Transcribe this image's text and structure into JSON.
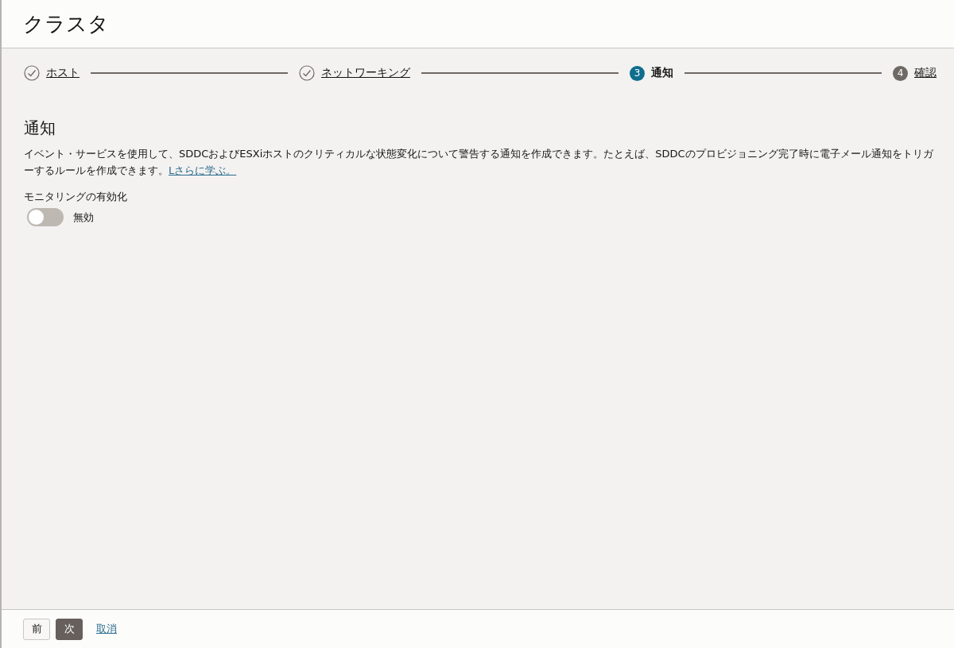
{
  "title": "クラスタ",
  "steps": [
    {
      "label": "ホスト",
      "kind": "done"
    },
    {
      "label": "ネットワーキング",
      "kind": "done"
    },
    {
      "number": "3",
      "label": "通知",
      "kind": "current"
    },
    {
      "number": "4",
      "label": "確認",
      "kind": "pending"
    }
  ],
  "section": {
    "heading": "通知",
    "description": "イベント・サービスを使用して、SDDCおよびESXiホストのクリティカルな状態変化について警告する通知を作成できます。たとえば、SDDCのプロビジョニング完了時に電子メール通知をトリガーするルールを作成できます。",
    "link": "Lさらに学ぶ。"
  },
  "monitoring": {
    "label": "モニタリングの有効化",
    "on": false,
    "state_text": "無効"
  },
  "footer": {
    "back": "前",
    "next": "次",
    "cancel": "取消"
  }
}
